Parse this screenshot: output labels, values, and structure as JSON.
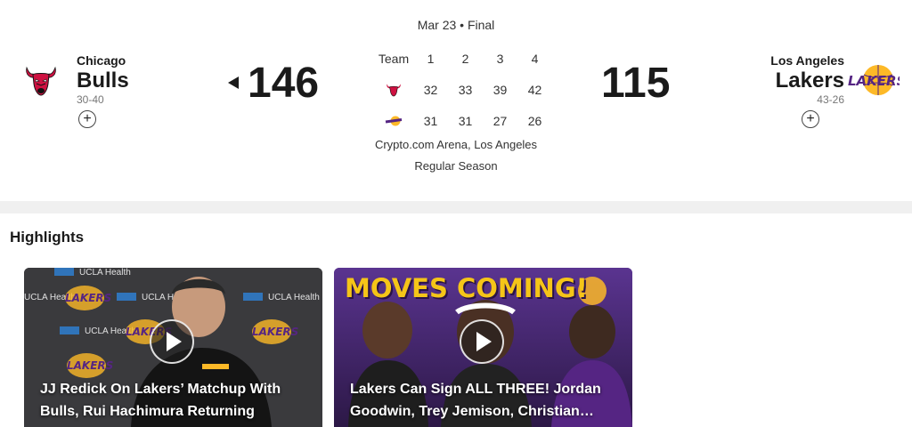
{
  "game": {
    "status": "Mar 23 • Final",
    "venue": "Crypto.com Arena, Los Angeles",
    "season_type": "Regular Season"
  },
  "home_team": {
    "city": "Chicago",
    "name": "Bulls",
    "record": "30-40",
    "score": "146",
    "logo_icon": "bulls-logo-icon",
    "color": "#ce1141"
  },
  "away_team": {
    "city": "Los Angeles",
    "name": "Lakers",
    "record": "43-26",
    "score": "115",
    "logo_icon": "lakers-logo-icon",
    "color": "#552583",
    "accent": "#fdb927"
  },
  "follow_symbol": "+",
  "linescore": {
    "header": [
      "Team",
      "1",
      "2",
      "3",
      "4"
    ],
    "rows": [
      {
        "team_icon": "bulls-logo-icon",
        "quarters": [
          "32",
          "33",
          "39",
          "42"
        ]
      },
      {
        "team_icon": "lakers-logo-icon",
        "quarters": [
          "31",
          "31",
          "27",
          "26"
        ]
      }
    ]
  },
  "highlights": {
    "title": "Highlights",
    "videos": [
      {
        "title": "JJ Redick On Lakers’ Matchup With Bulls, Rui Hachimura Returning",
        "backdrop_text": [
          "UCLA Health",
          "LAKERS"
        ]
      },
      {
        "title": "Lakers Can Sign ALL THREE! Jordan Goodwin, Trey Jemison, Christian…",
        "banner": "MOVES COMING!"
      }
    ]
  }
}
